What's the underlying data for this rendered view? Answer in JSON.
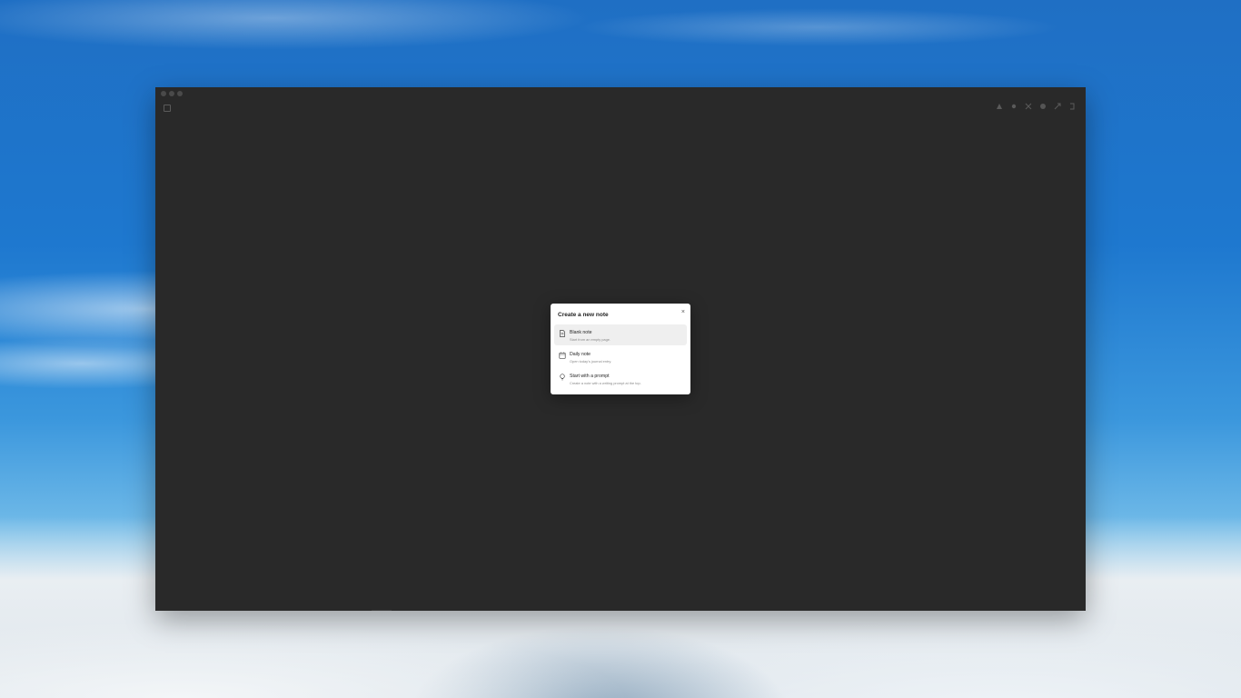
{
  "dialog": {
    "title": "Create a new note",
    "close_symbol": "×",
    "options": [
      {
        "icon": "document-icon",
        "title": "Blank note",
        "description": "Start from an empty page.",
        "selected": true
      },
      {
        "icon": "calendar-icon",
        "title": "Daily note",
        "description": "Open today's journal entry.",
        "selected": false
      },
      {
        "icon": "lightbulb-icon",
        "title": "Start with a prompt",
        "description": "Create a note with a writing prompt at the top.",
        "selected": false
      }
    ]
  },
  "toolbar": {
    "icons": [
      "share-icon",
      "sparkle-icon",
      "close-icon",
      "circle-icon",
      "expand-icon",
      "panel-icon"
    ]
  },
  "colors": {
    "window_bg": "#292929",
    "dialog_bg": "#ffffff",
    "selected_row": "#efefef"
  }
}
